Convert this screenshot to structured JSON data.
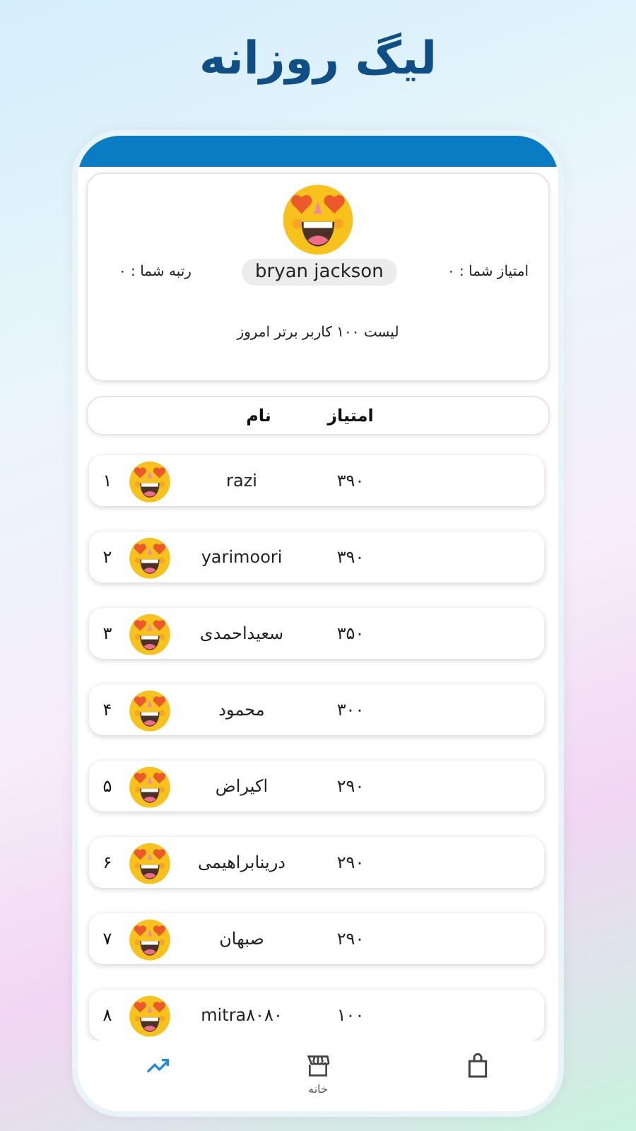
{
  "title": "لیگ روزانه",
  "profile": {
    "username": "bryan jackson",
    "score_label": "امتیاز شما : ۰",
    "rank_label": "رتبه شما : ۰",
    "caption": "لیست ۱۰۰ کاربر برتر امروز"
  },
  "table": {
    "columns": [
      "امتیاز",
      "نام"
    ],
    "rows": [
      {
        "rank": "۱",
        "name": "razi",
        "score": "۳۹۰"
      },
      {
        "rank": "۲",
        "name": "yarimoori",
        "score": "۳۹۰"
      },
      {
        "rank": "۳",
        "name": "سعیداحمدی",
        "score": "۳۵۰"
      },
      {
        "rank": "۴",
        "name": "محمود",
        "score": "۳۰۰"
      },
      {
        "rank": "۵",
        "name": "اکیراض",
        "score": "۲۹۰"
      },
      {
        "rank": "۶",
        "name": "درینابراهیمی",
        "score": "۲۹۰"
      },
      {
        "rank": "۷",
        "name": "صبهان",
        "score": "۲۹۰"
      },
      {
        "rank": "۸",
        "name": "mitra۸۰۸۰",
        "score": "۱۰۰"
      }
    ]
  },
  "nav": [
    {
      "kind": "trending",
      "selected": true
    },
    {
      "kind": "store",
      "label": "خانه",
      "selected": false
    },
    {
      "kind": "bag",
      "selected": false
    }
  ]
}
